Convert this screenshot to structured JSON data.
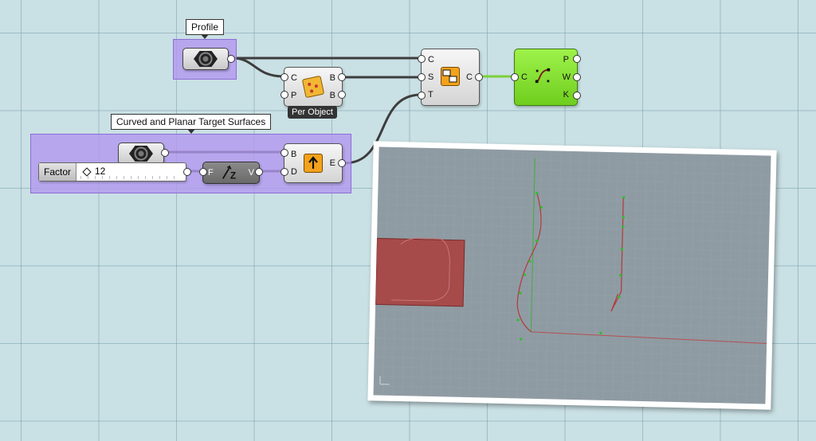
{
  "groups": {
    "profile": {
      "label": "Profile"
    },
    "targets": {
      "label": "Curved and Planar Target Surfaces"
    }
  },
  "components": {
    "per_object": {
      "inputs": [
        "C",
        "P"
      ],
      "outputs": [
        "B",
        "B"
      ],
      "tag": "Per Object",
      "icon": "dice-icon"
    },
    "transform": {
      "inputs": [
        "C",
        "S",
        "T"
      ],
      "outputs": [
        "C"
      ],
      "icon": "orient-icon"
    },
    "curve_params": {
      "inputs": [
        "C"
      ],
      "outputs": [
        "P",
        "W",
        "K"
      ],
      "icon": "nurbs-curve-icon",
      "color": "#86e236"
    },
    "surface_frame": {
      "inputs": [
        "B",
        "D"
      ],
      "outputs": [
        "E"
      ],
      "icon": "extrude-arrow-icon"
    },
    "unit_z": {
      "inputs": [
        "F"
      ],
      "outputs": [
        "V"
      ],
      "icon": "unit-z-vector-icon"
    }
  },
  "slider": {
    "label": "Factor",
    "value": "12"
  },
  "colors": {
    "canvas": "#c9e0e4",
    "group": "#b296f0",
    "wire": "#3d3d3d",
    "selected_wire": "#7ad13a"
  }
}
